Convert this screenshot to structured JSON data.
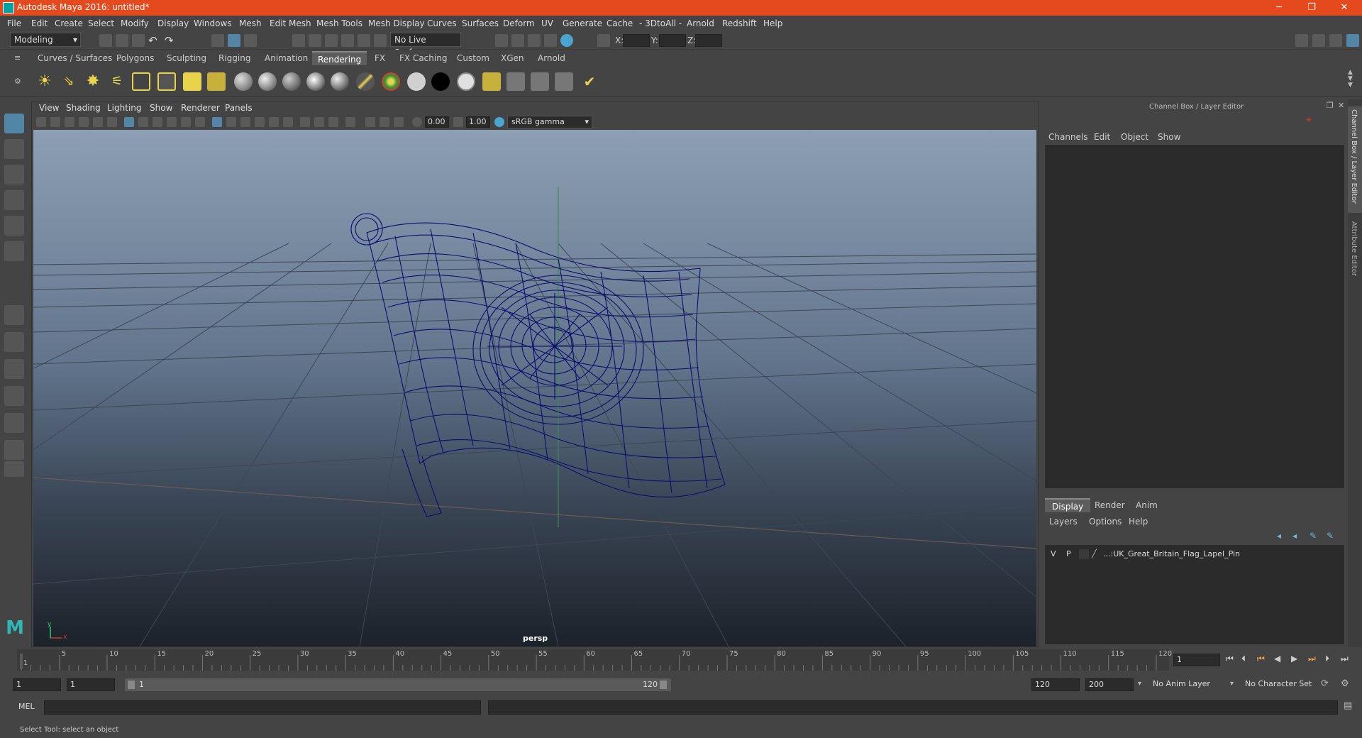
{
  "window": {
    "title": "Autodesk Maya 2016: untitled*",
    "minimize": "─",
    "maximize": "❐",
    "close": "✕"
  },
  "menubar": [
    "File",
    "Edit",
    "Create",
    "Select",
    "Modify",
    "Display",
    "Windows",
    "Mesh",
    "Edit Mesh",
    "Mesh Tools",
    "Mesh Display",
    "Curves",
    "Surfaces",
    "Deform",
    "UV",
    "Generate",
    "Cache",
    "- 3DtoAll -",
    "Arnold",
    "Redshift",
    "Help"
  ],
  "statusline": {
    "mode": "Modeling",
    "live_surface": "No Live Surface",
    "x_label": "X:",
    "y_label": "Y:",
    "z_label": "Z:"
  },
  "shelf_tabs": [
    "Curves / Surfaces",
    "Polygons",
    "Sculpting",
    "Rigging",
    "Animation",
    "Rendering",
    "FX",
    "FX Caching",
    "Custom",
    "XGen",
    "Arnold"
  ],
  "active_shelf_tab": "Rendering",
  "panel_menu": [
    "View",
    "Shading",
    "Lighting",
    "Show",
    "Renderer",
    "Panels"
  ],
  "panel_toolbar": {
    "exposure": "0.00",
    "gamma": "1.00",
    "color_space": "sRGB gamma"
  },
  "viewport": {
    "camera_label": "persp",
    "axis_x": "x",
    "axis_y": "y",
    "wire_color": "#0b0d6e"
  },
  "channel_box": {
    "header": "Channel Box / Layer Editor",
    "menus": [
      "Channels",
      "Edit",
      "Object",
      "Show"
    ]
  },
  "layer_editor": {
    "tabs": [
      "Display",
      "Render",
      "Anim"
    ],
    "active_tab": "Display",
    "menus": [
      "Layers",
      "Options",
      "Help"
    ],
    "layer": {
      "v": "V",
      "p": "P",
      "name": "...:UK_Great_Britain_Flag_Lapel_Pin"
    }
  },
  "side_tabs": [
    "Channel Box / Layer Editor",
    "Attribute Editor"
  ],
  "timeslider": {
    "ticks": [
      "1",
      "5",
      "10",
      "15",
      "20",
      "25",
      "30",
      "35",
      "40",
      "45",
      "50",
      "55",
      "60",
      "65",
      "70",
      "75",
      "80",
      "85",
      "90",
      "95",
      "100",
      "105",
      "110",
      "115",
      "120"
    ],
    "current_frame": "1"
  },
  "range": {
    "start": "1",
    "playback_start": "1",
    "slider_start": "1",
    "slider_end": "120",
    "playback_end": "120",
    "end": "200",
    "anim_layer": "No Anim Layer",
    "character_set": "No Character Set"
  },
  "cmdline": {
    "label": "MEL"
  },
  "helpline": {
    "text": "Select Tool: select an object"
  },
  "colors": {
    "titlebar": "#e54a1e",
    "accent_blue": "#5285a6"
  }
}
